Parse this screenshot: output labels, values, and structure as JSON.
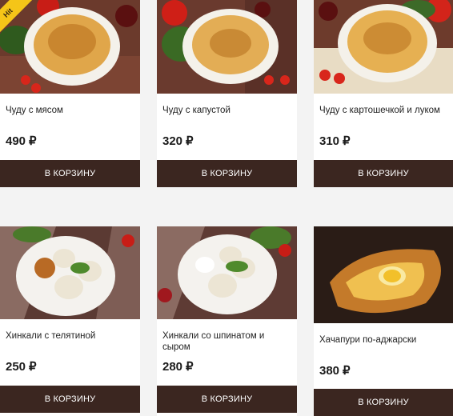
{
  "currency": "₽",
  "products": [
    {
      "name": "Чуду с мясом",
      "price": "490",
      "button": "В КОРЗИНУ",
      "badge": "Hit"
    },
    {
      "name": "Чуду с капустой",
      "price": "320",
      "button": "В КОРЗИНУ"
    },
    {
      "name": "Чуду с картошечкой и луком",
      "price": "310",
      "button": "В КОРЗИНУ"
    },
    {
      "name": "Хинкали с телятиной",
      "price": "250",
      "button": "В КОРЗИНУ"
    },
    {
      "name": "Хинкали со шпинатом и сыром",
      "price": "280",
      "button": "В КОРЗИНУ"
    },
    {
      "name": "Хачапури по-аджарски",
      "price": "380",
      "button": "В КОРЗИНУ"
    }
  ]
}
